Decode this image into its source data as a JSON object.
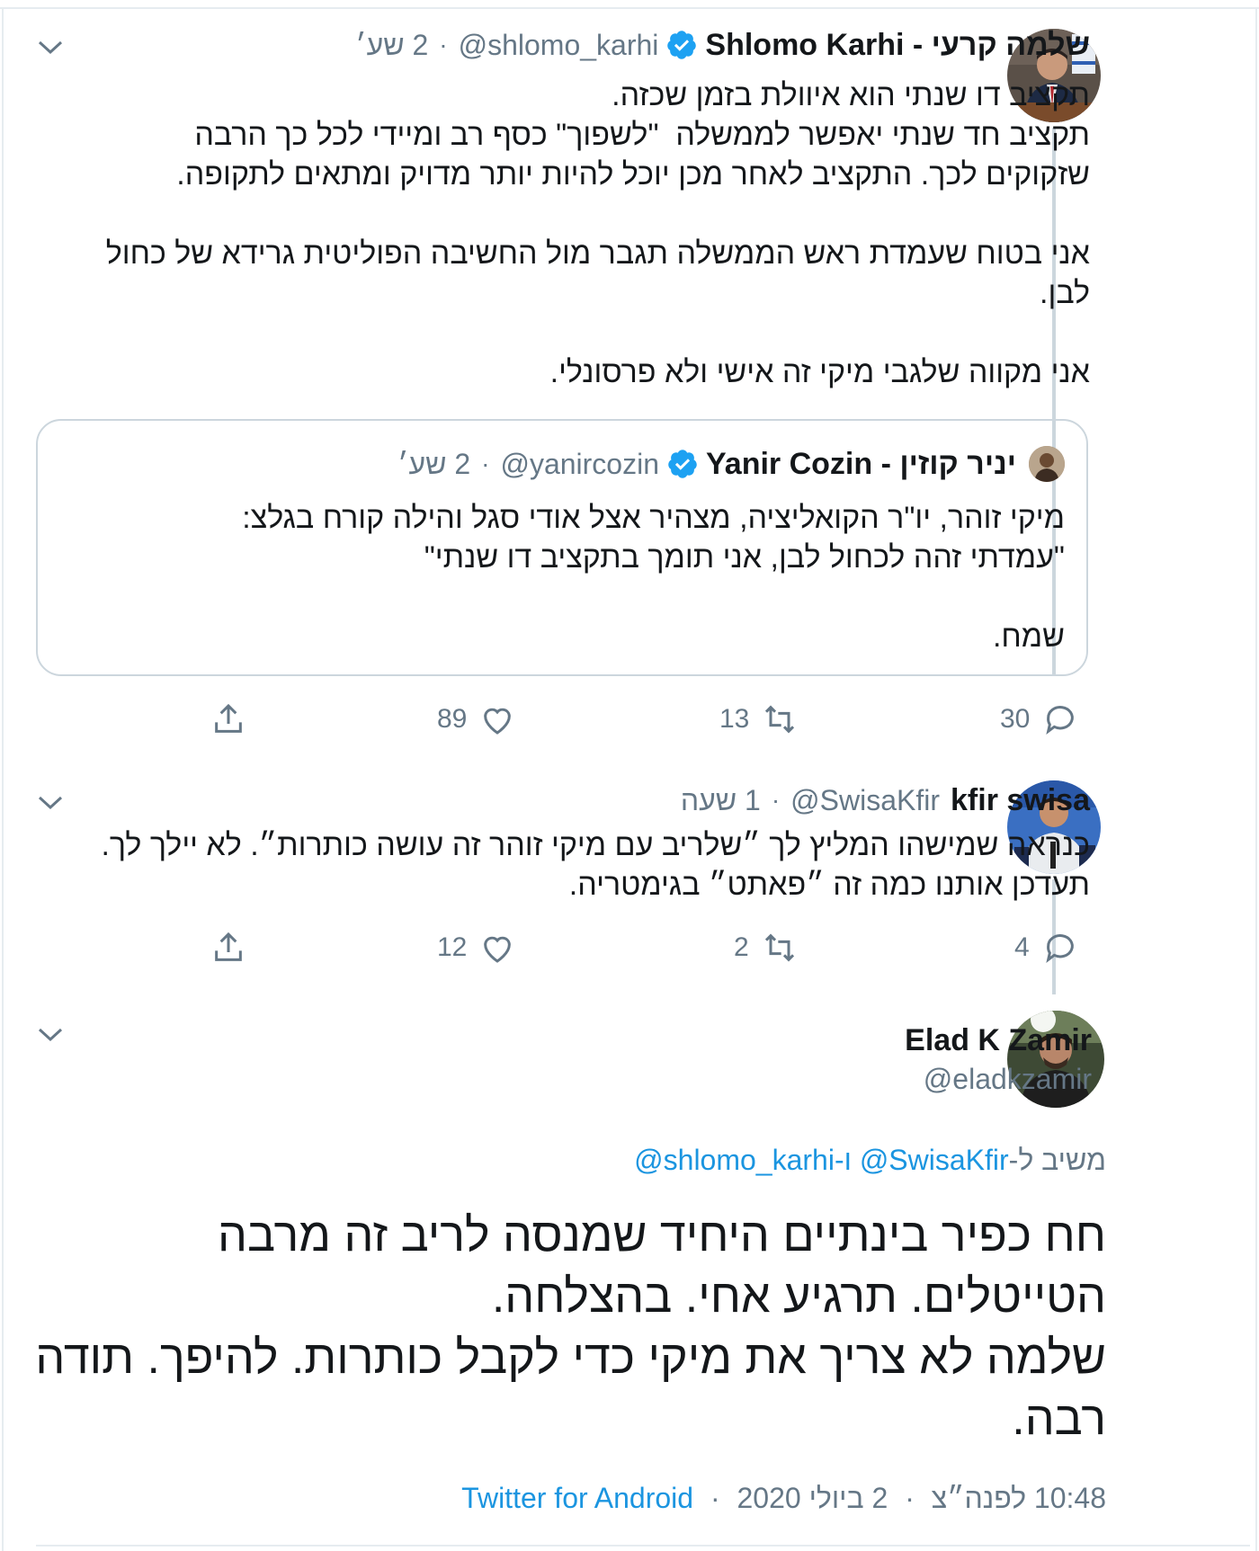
{
  "tweet1": {
    "name": "שלמה קרעי - Shlomo Karhi",
    "handle": "@shlomo_karhi",
    "time": "2 שע׳",
    "body": "תקציב דו שנתי הוא איוולת בזמן שכזה.\nתקציב חד שנתי יאפשר לממשלה  \"לשפוך\" כסף רב ומיידי לכל כך הרבה שזקוקים לכך. התקציב לאחר מכן יוכל להיות יותר מדויק ומתאים לתקופה.\n\nאני בטוח שעמדת ראש הממשלה תגבר מול החשיבה הפוליטית גרידא של כחול לבן.\n\nאני מקווה שלגבי מיקי זה אישי ולא פרסונלי.",
    "quote": {
      "name": "יניר קוזין - Yanir Cozin",
      "handle": "@yanircozin",
      "time": "2 שע׳",
      "body": "מיקי זוהר, יו\"ר הקואליציה, מצהיר אצל אודי סגל והילה קורח בגלצ:\n\"עמדתי זהה לכחול לבן, אני תומך בתקציב דו שנתי\"\n\nשמח."
    },
    "actions": {
      "replies": "30",
      "retweets": "13",
      "likes": "89"
    }
  },
  "tweet2": {
    "name": "kfir swisa",
    "handle": "@SwisaKfir",
    "time": "1 שעה",
    "body": "כנראה שמישהו המליץ לך ״שלריב עם מיקי זוהר זה עושה כותרות״. לא יילך לך. תעדכן אותנו כמה זה ״פאתט״ בגימטריה.",
    "actions": {
      "replies": "4",
      "retweets": "2",
      "likes": "12"
    }
  },
  "main_tweet": {
    "name": "Elad K Zamir",
    "handle": "@eladkzamir",
    "reply_prefix": "משיב ל-",
    "reply_to_1": "@SwisaKfir",
    "reply_join": " ו-",
    "reply_to_2": "@shlomo_karhi",
    "body": "חח כפיר בינתיים היחיד שמנסה לריב זה מרבה הטייטלים. תרגיע אחי. בהצלחה.\nשלמה לא צריך את מיקי כדי לקבל כותרות. להיפך. תודה רבה.",
    "time": "10:48 לפנה״צ",
    "date": "2 ביולי 2020",
    "source": "Twitter for Android"
  },
  "icons": {
    "reply": "reply-icon",
    "retweet": "retweet-icon",
    "like": "heart-icon",
    "share": "share-icon",
    "caret": "chevron-down-icon",
    "verified": "verified-badge-icon"
  },
  "colors": {
    "link": "#1b95e0",
    "muted": "#657786",
    "verified": "#1da1f2",
    "text": "#14171a"
  }
}
